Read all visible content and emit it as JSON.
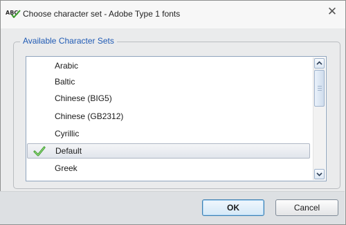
{
  "window": {
    "title": "Choose character set - Adobe Type 1 fonts",
    "app_icon": "abc-spellcheck-icon",
    "close_glyph": "✕"
  },
  "group": {
    "label": "Available Character Sets"
  },
  "charsets": {
    "items": [
      {
        "label": "Arabic",
        "checked": false
      },
      {
        "label": "Baltic",
        "checked": false
      },
      {
        "label": "Chinese (BIG5)",
        "checked": false
      },
      {
        "label": "Chinese (GB2312)",
        "checked": false
      },
      {
        "label": "Cyrillic",
        "checked": false
      },
      {
        "label": "Default",
        "checked": true
      },
      {
        "label": "Greek",
        "checked": false
      }
    ],
    "selected": "Default"
  },
  "buttons": {
    "ok_label": "OK",
    "cancel_label": "Cancel"
  },
  "colors": {
    "accent": "#1f5ab4",
    "check_green": "#3a9a2a"
  }
}
